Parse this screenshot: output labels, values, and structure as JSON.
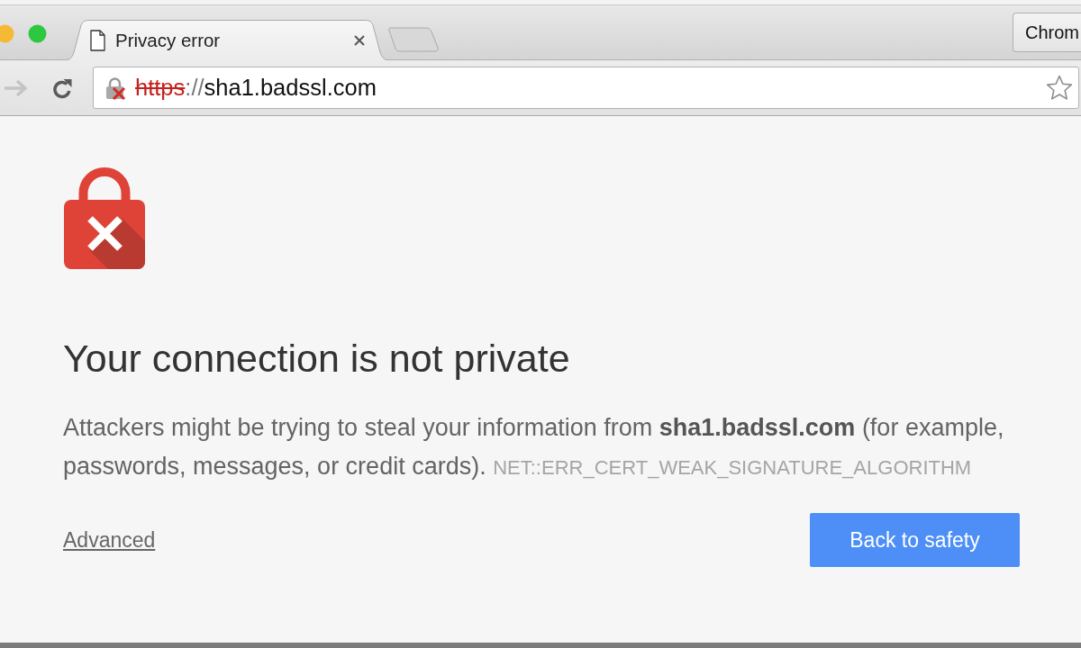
{
  "tabs": [
    {
      "title": "Privacy error",
      "selected": true
    }
  ],
  "profile_button": {
    "label": "Chrom"
  },
  "toolbar": {
    "forward": {
      "disabled": true
    }
  },
  "address_bar": {
    "scheme": "https",
    "separator": "://",
    "host": "sha1.badssl.com",
    "secure": false
  },
  "interstitial": {
    "heading": "Your connection is not private",
    "message": "Attackers might be trying to steal your information from **sha1.badssl.com** (for example, passwords, messages, or credit cards).",
    "error_code": "NET::ERR_CERT_WEAK_SIGNATURE_ALGORITHM",
    "advanced_link": "Advanced",
    "primary_button": "Back to safety"
  }
}
